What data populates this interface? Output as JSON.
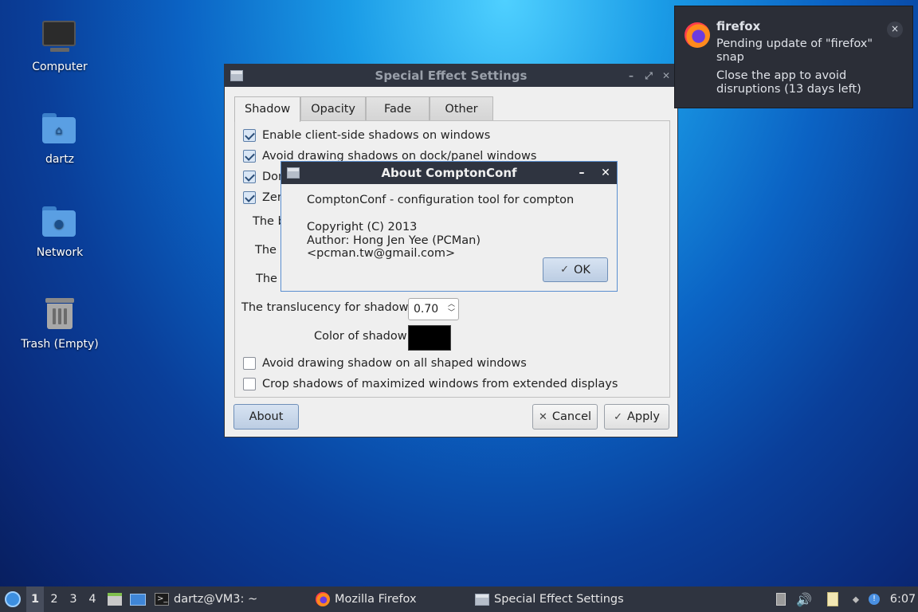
{
  "desktop": {
    "icons": [
      {
        "label": "Computer"
      },
      {
        "label": "dartz"
      },
      {
        "label": "Network"
      },
      {
        "label": "Trash (Empty)"
      }
    ]
  },
  "settings_window": {
    "title": "Special Effect Settings",
    "tabs": [
      "Shadow",
      "Opacity",
      "Fade",
      "Other"
    ],
    "active_tab": "Shadow",
    "options": [
      {
        "label": "Enable client-side shadows on windows",
        "checked": true
      },
      {
        "label": "Avoid drawing shadows on dock/panel windows",
        "checked": true
      },
      {
        "label": "Don",
        "checked": true
      },
      {
        "label": "Zero",
        "checked": true
      }
    ],
    "partial_labels": [
      "The b",
      "The l",
      "The t"
    ],
    "translucency_label": "The translucency for shadows",
    "translucency_value": "0.70",
    "color_label": "Color of shadow",
    "shadow_color": "#000000",
    "options_bottom": [
      {
        "label": "Avoid drawing shadow on all shaped windows",
        "checked": false
      },
      {
        "label": "Crop shadows of maximized windows from extended displays",
        "checked": false
      }
    ],
    "about_button": "About",
    "cancel_button": "Cancel",
    "apply_button": "Apply"
  },
  "about_dialog": {
    "title": "About ComptonConf",
    "description": "ComptonConf - configuration tool for compton",
    "copyright": "Copyright (C) 2013",
    "author": "Author: Hong Jen Yee (PCMan) <pcman.tw@gmail.com>",
    "ok_button": "OK"
  },
  "notification": {
    "app": "firefox",
    "message_1": "Pending update of \"firefox\" snap",
    "message_2": "Close the app to avoid disruptions (13 days left)",
    "close_glyph": "×"
  },
  "taskbar": {
    "workspaces": [
      "1",
      "2",
      "3",
      "4"
    ],
    "active_workspace": "1",
    "tasks": [
      {
        "label": "dartz@VM3: ~",
        "icon": "terminal-icon"
      },
      {
        "label": "Mozilla Firefox",
        "icon": "firefox-icon"
      },
      {
        "label": "Special Effect Settings",
        "icon": "window-icon"
      }
    ],
    "clock": "6:07"
  }
}
